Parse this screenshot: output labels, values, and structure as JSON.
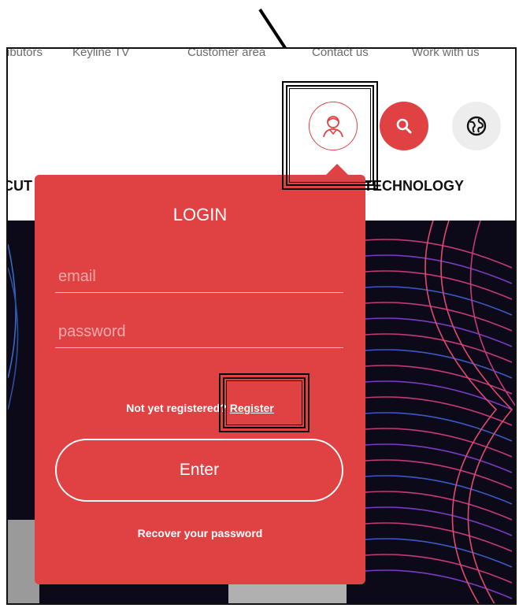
{
  "topnav": {
    "items": [
      "ributors",
      "Keyline TV",
      "Customer area",
      "Contact us",
      "Work with us"
    ]
  },
  "header": {
    "user_icon": "user-icon",
    "search_icon": "search-icon",
    "globe_icon": "globe-icon",
    "accent_color": "#e04244"
  },
  "mainnav": {
    "items": [
      "CUT",
      "TECHNOLOGY"
    ]
  },
  "login": {
    "title": "LOGIN",
    "email_placeholder": "email",
    "password_placeholder": "password",
    "not_registered": "Not yet registered? ",
    "register_link": "Register",
    "enter_label": "Enter",
    "recover_label": "Recover your password"
  }
}
